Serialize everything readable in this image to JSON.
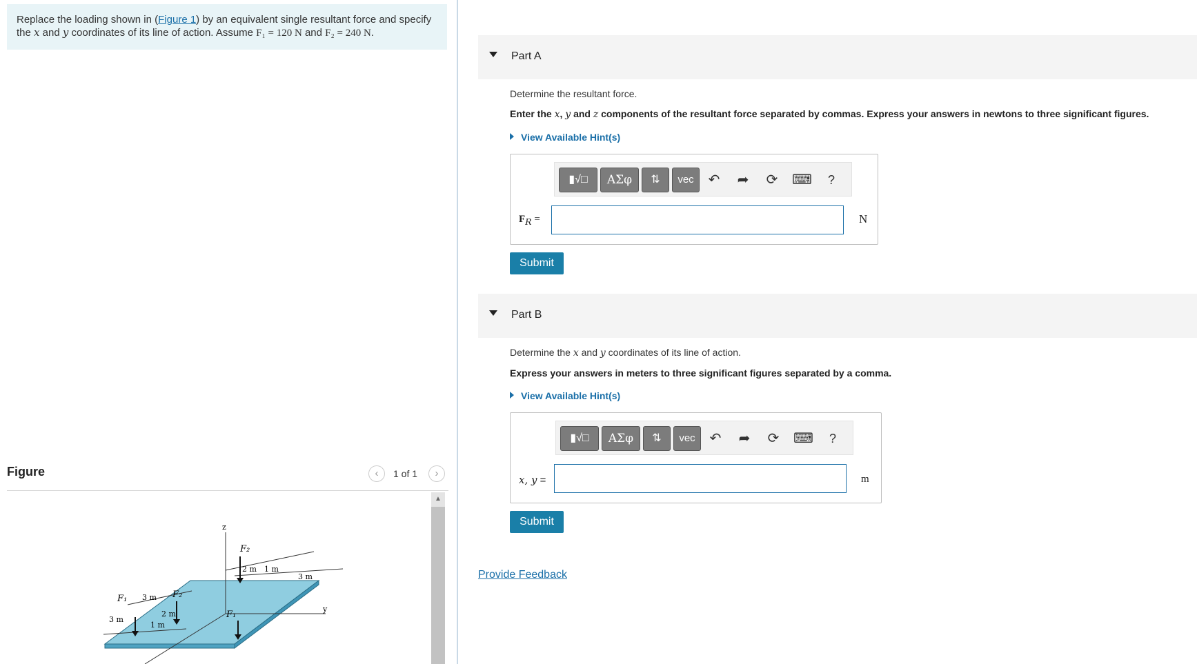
{
  "problem": {
    "text_before": "Replace the loading shown in (",
    "figure_link": "Figure 1",
    "text_after_link": ") by an equivalent single resultant force and specify",
    "line2_the": "the ",
    "x_var": "x",
    "and": " and ",
    "y_var": "y",
    "line2_rest": " coordinates of its line of action. Assume ",
    "f1_eq": "F₁ = 120 N",
    "and2": " and ",
    "f2_eq": "F₂ = 240 N",
    "period": "."
  },
  "figure_panel": {
    "title": "Figure",
    "pager": "1 of 1",
    "prev_icon": "chevron-left-icon",
    "next_icon": "chevron-right-icon",
    "labels": {
      "z": "z",
      "y": "y",
      "F2_top": "F₂",
      "F2_mid": "F₂",
      "F1_left": "F₁",
      "F1_right": "F₁",
      "d_2m_top": "2 m",
      "d_1m_top": "1 m",
      "d_3m_top": "3 m",
      "d_3m_left": "3 m",
      "d_3m_edge": "3 m",
      "d_2m_mid": "2 m",
      "d_1m_bot": "1 m"
    }
  },
  "part_a": {
    "title": "Part A",
    "question": "Determine the resultant force.",
    "instr_pre": "Enter the ",
    "instr_x": "x",
    "instr_sep1": ", ",
    "instr_y": "y",
    "instr_and": " and ",
    "instr_z": "z",
    "instr_post": " components of the resultant force separated by commas. Express your answers in newtons to three significant figures.",
    "hint": "View Available Hint(s)",
    "label_main": "F",
    "label_sub": "R",
    "label_eq": " =",
    "input_value": "",
    "unit": "N",
    "submit": "Submit"
  },
  "part_b": {
    "title": "Part B",
    "q_pre": "Determine the ",
    "q_x": "x",
    "q_and": " and ",
    "q_y": "y",
    "q_post": " coordinates of its line of action.",
    "instr": "Express your answers in meters to three significant figures separated by a comma.",
    "hint": "View Available Hint(s)",
    "label": "x, y",
    "label_eq": " =",
    "input_value": "",
    "unit": "m",
    "submit": "Submit"
  },
  "toolbar": {
    "templates": "▮√□",
    "greek": "ΑΣφ",
    "arrows": "⇅",
    "vec": "vec",
    "undo_icon": "undo-icon",
    "redo_icon": "redo-icon",
    "reset_icon": "reset-icon",
    "keyboard_icon": "keyboard-icon",
    "help": "?"
  },
  "feedback": "Provide Feedback",
  "colors": {
    "link": "#1a6fa8",
    "submit": "#1a7fa8",
    "problem_bg": "#e8f4f7",
    "plate": "#8fcde0"
  }
}
